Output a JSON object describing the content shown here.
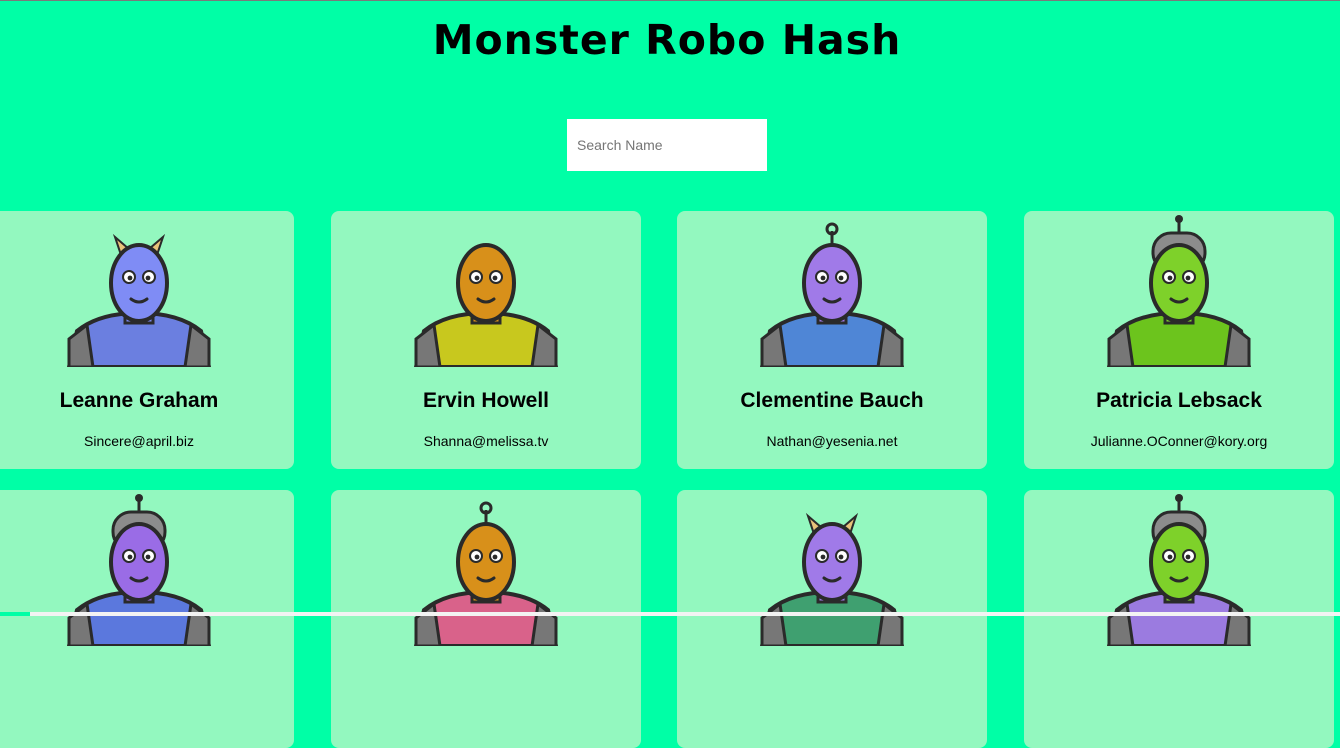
{
  "header": {
    "title": "Monster Robo Hash"
  },
  "search": {
    "placeholder": "Search Name",
    "value": ""
  },
  "monsters": [
    {
      "name": "Leanne Graham",
      "email": "Sincere@april.biz",
      "skin_color": "#7f8cf5",
      "shirt_color": "#6b7fe0",
      "head": "horns",
      "avatar_icon": "blue-horned-monster-icon"
    },
    {
      "name": "Ervin Howell",
      "email": "Shanna@melissa.tv",
      "skin_color": "#d8901a",
      "shirt_color": "#c8c81e",
      "head": "bald",
      "avatar_icon": "orange-spiky-monster-icon"
    },
    {
      "name": "Clementine Bauch",
      "email": "Nathan@yesenia.net",
      "skin_color": "#a07ae8",
      "shirt_color": "#4f86d6",
      "head": "antenna",
      "avatar_icon": "purple-cyclops-robot-icon"
    },
    {
      "name": "Patricia Lebsack",
      "email": "Julianne.OConner@kory.org",
      "skin_color": "#7ed12a",
      "shirt_color": "#6cc41d",
      "head": "helmet",
      "avatar_icon": "green-helmet-robot-icon"
    },
    {
      "name": "",
      "email": "",
      "skin_color": "#9a6ce6",
      "shirt_color": "#5b78dd",
      "head": "helmet",
      "avatar_icon": "purple-helmet-robot-icon"
    },
    {
      "name": "",
      "email": "",
      "skin_color": "#d8901a",
      "shirt_color": "#d9628a",
      "head": "antenna",
      "avatar_icon": "orange-antenna-monster-icon"
    },
    {
      "name": "",
      "email": "",
      "skin_color": "#a07ae8",
      "shirt_color": "#3fa070",
      "head": "horns",
      "avatar_icon": "purple-horned-monster-icon"
    },
    {
      "name": "",
      "email": "",
      "skin_color": "#7ed12a",
      "shirt_color": "#9b7be0",
      "head": "helmet",
      "avatar_icon": "green-helmet-robot-icon"
    }
  ]
}
